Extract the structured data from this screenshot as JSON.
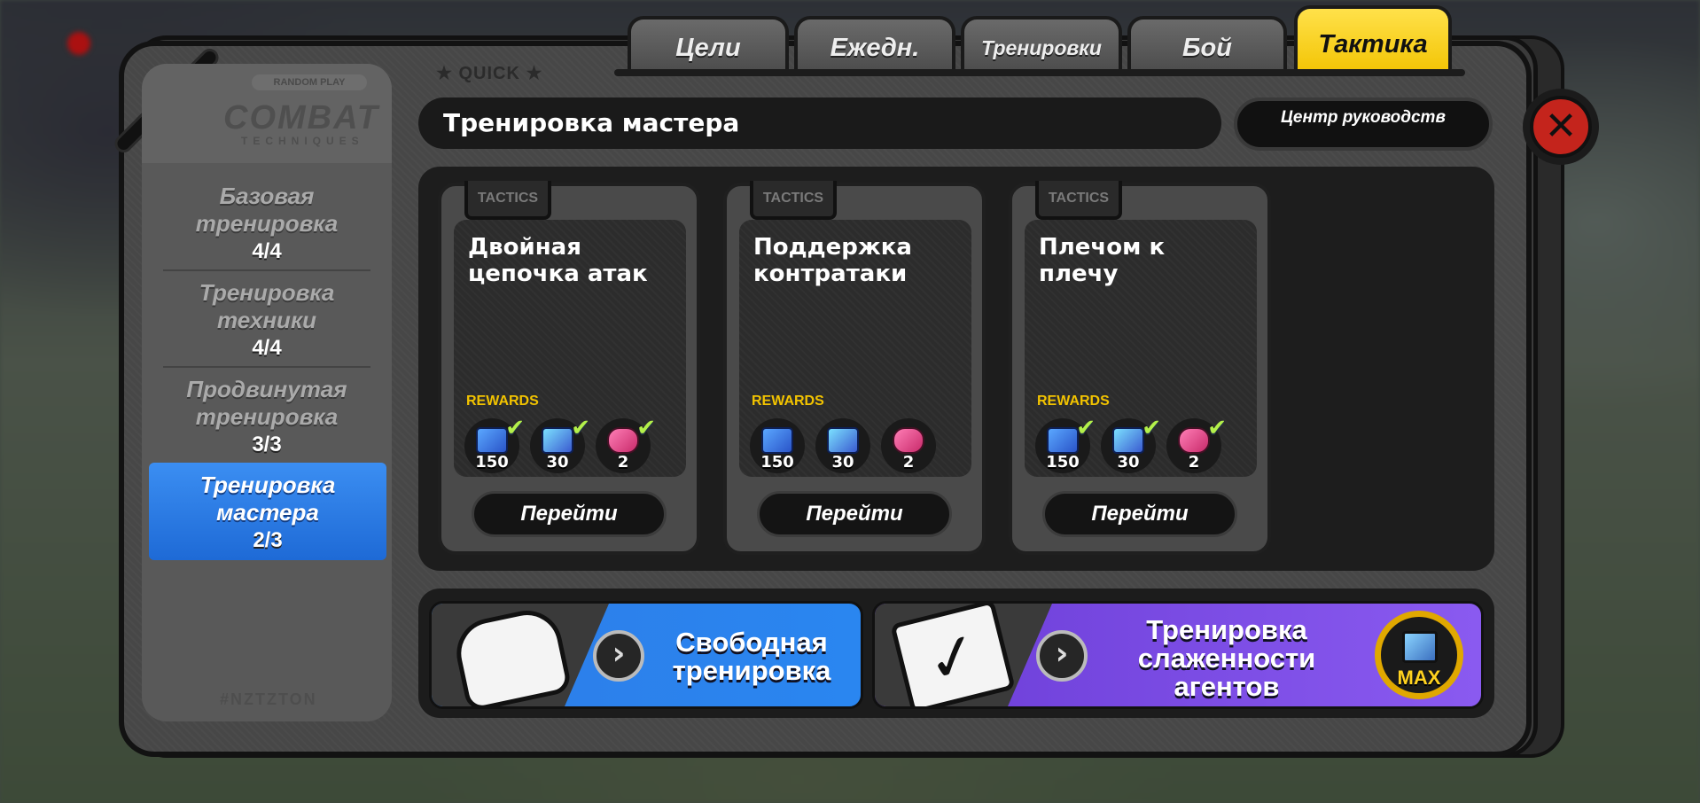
{
  "tabs": [
    {
      "label": "Цели"
    },
    {
      "label": "Ежедн."
    },
    {
      "label": "Тренировки"
    },
    {
      "label": "Бой"
    },
    {
      "label": "Тактика"
    }
  ],
  "active_tab": "Тактика",
  "quick_label": "QUICK",
  "sidebar": {
    "logo_badge": "RANDOM PLAY",
    "logo_title": "COMBAT",
    "logo_subtitle": "TECHNIQUES",
    "footer": "#NZTZTON",
    "items": [
      {
        "label": "Базовая тренировка",
        "count": "4/4",
        "active": false
      },
      {
        "label": "Тренировка техники",
        "count": "4/4",
        "active": false
      },
      {
        "label": "Продвинутая тренировка",
        "count": "3/3",
        "active": false
      },
      {
        "label": "Тренировка мастера",
        "count": "2/3",
        "active": true
      }
    ]
  },
  "header": {
    "title": "Тренировка мастера",
    "guide_button": "Центр руководств"
  },
  "cards": [
    {
      "tag": "TACTICS",
      "title": "Двойная цепочка атак",
      "rewards_label": "REWARDS",
      "rewards": [
        {
          "icon": "blueprint-icon",
          "amount": "150",
          "claimed": true
        },
        {
          "icon": "data-chip-icon",
          "amount": "30",
          "claimed": true
        },
        {
          "icon": "pink-gem-icon",
          "amount": "2",
          "claimed": true
        }
      ],
      "button": "Перейти"
    },
    {
      "tag": "TACTICS",
      "title": "Поддержка контратаки",
      "rewards_label": "REWARDS",
      "rewards": [
        {
          "icon": "blueprint-icon",
          "amount": "150",
          "claimed": false
        },
        {
          "icon": "data-chip-icon",
          "amount": "30",
          "claimed": false
        },
        {
          "icon": "pink-gem-icon",
          "amount": "2",
          "claimed": false
        }
      ],
      "button": "Перейти"
    },
    {
      "tag": "TACTICS",
      "title": "Плечом к плечу",
      "rewards_label": "REWARDS",
      "rewards": [
        {
          "icon": "blueprint-icon",
          "amount": "150",
          "claimed": true
        },
        {
          "icon": "data-chip-icon",
          "amount": "30",
          "claimed": true
        },
        {
          "icon": "pink-gem-icon",
          "amount": "2",
          "claimed": true
        }
      ],
      "button": "Перейти"
    }
  ],
  "banners": {
    "free_training": {
      "label": "Свободная тренировка",
      "icon": "boxing-glove-icon"
    },
    "team_training": {
      "label": "Тренировка слаженности агентов",
      "icon": "book-check-icon",
      "badge": "MAX"
    }
  },
  "colors": {
    "accent_yellow": "#f2c300",
    "active_blue": "#2a7be6",
    "purple": "#7b4bdb",
    "close_red": "#c4241c",
    "check_green": "#b4f04a"
  }
}
